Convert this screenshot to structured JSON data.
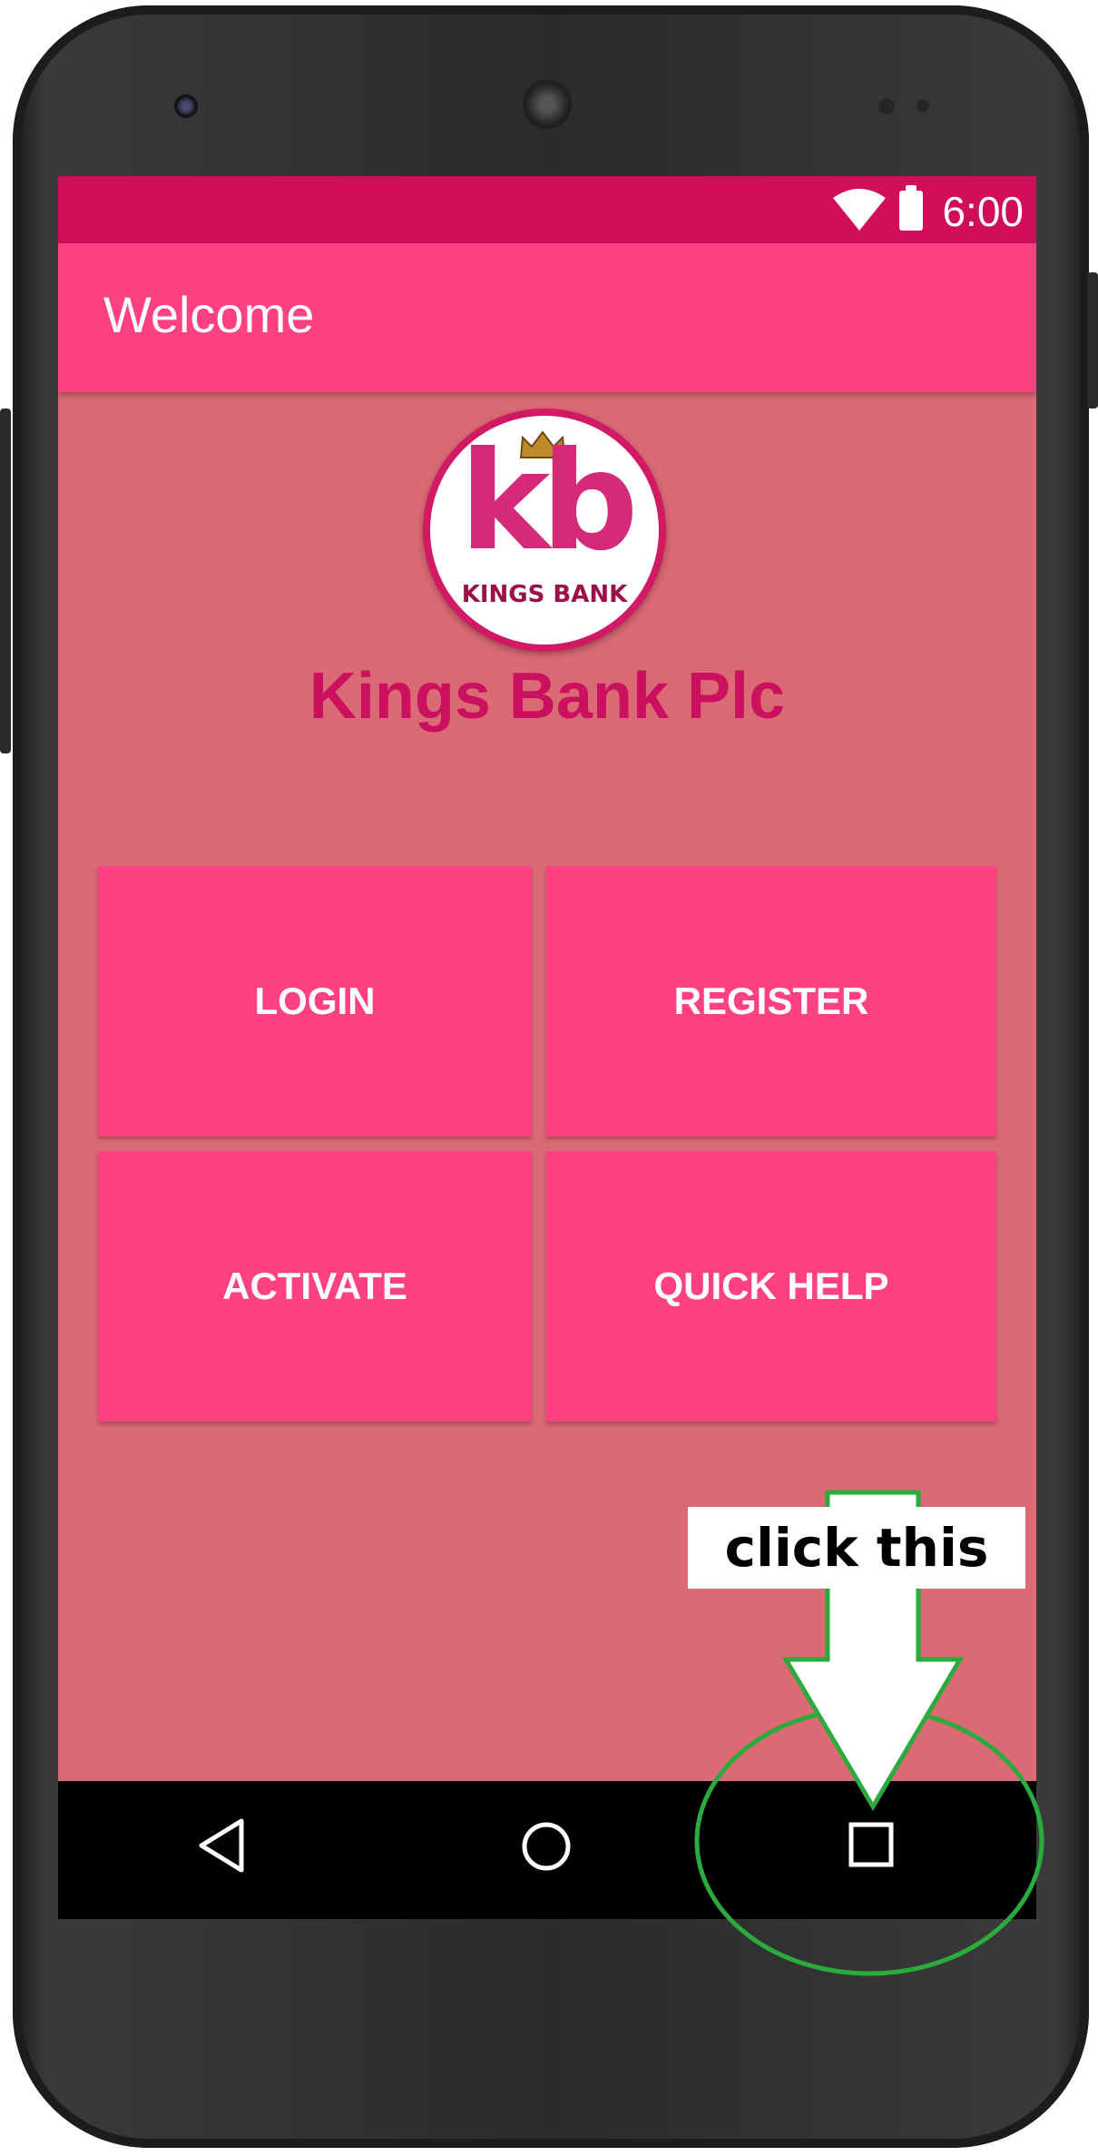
{
  "status_bar": {
    "time": "6:00",
    "wifi_icon": "wifi-icon",
    "battery_icon": "battery-icon"
  },
  "app_bar": {
    "title": "Welcome"
  },
  "logo": {
    "monogram": "kb",
    "wordmark": "KINGS BANK"
  },
  "brand": {
    "name": "Kings Bank Plc"
  },
  "tiles": [
    {
      "label": "LOGIN"
    },
    {
      "label": "REGISTER"
    },
    {
      "label": "ACTIVATE"
    },
    {
      "label": "QUICK HELP"
    }
  ],
  "nav_bar": {
    "back_icon": "back-triangle-icon",
    "home_icon": "home-circle-icon",
    "recents_icon": "recents-square-icon"
  },
  "annotation": {
    "label": "click this",
    "arrow_color": "#2bab3e",
    "circle_color": "#2bab3e"
  },
  "colors": {
    "status_bar": "#d10c5a",
    "app_bar": "#ff4081",
    "content_bg": "#db6a75",
    "brand_text": "#cc1060",
    "tile_bg": "#ff4081"
  }
}
